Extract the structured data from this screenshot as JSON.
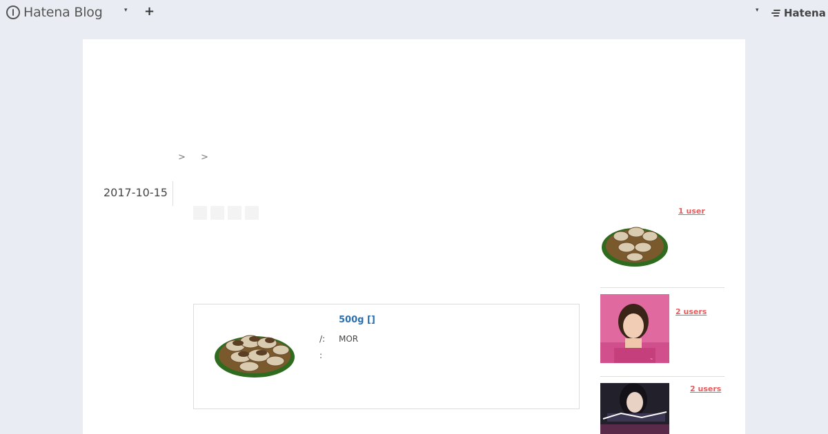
{
  "header": {
    "logo_text": "Hatena Blog",
    "add_label": "+",
    "brand_right": "Hatena",
    "caret": "▾"
  },
  "breadcrumb": {
    "sep1": ">",
    "sep2": ">"
  },
  "entry": {
    "date": "2017-10-15"
  },
  "product": {
    "title": "500g []",
    "key1": "/:",
    "value1": "MOR",
    "key2": ":"
  },
  "sidebar": {
    "items": [
      {
        "users": "1 user"
      },
      {
        "users": "2 users"
      },
      {
        "users": "2 users"
      }
    ]
  },
  "colors": {
    "background": "#e9ecf3",
    "card": "#ffffff",
    "link_blue": "#2a6fb0",
    "users_red": "#e45c5c"
  }
}
